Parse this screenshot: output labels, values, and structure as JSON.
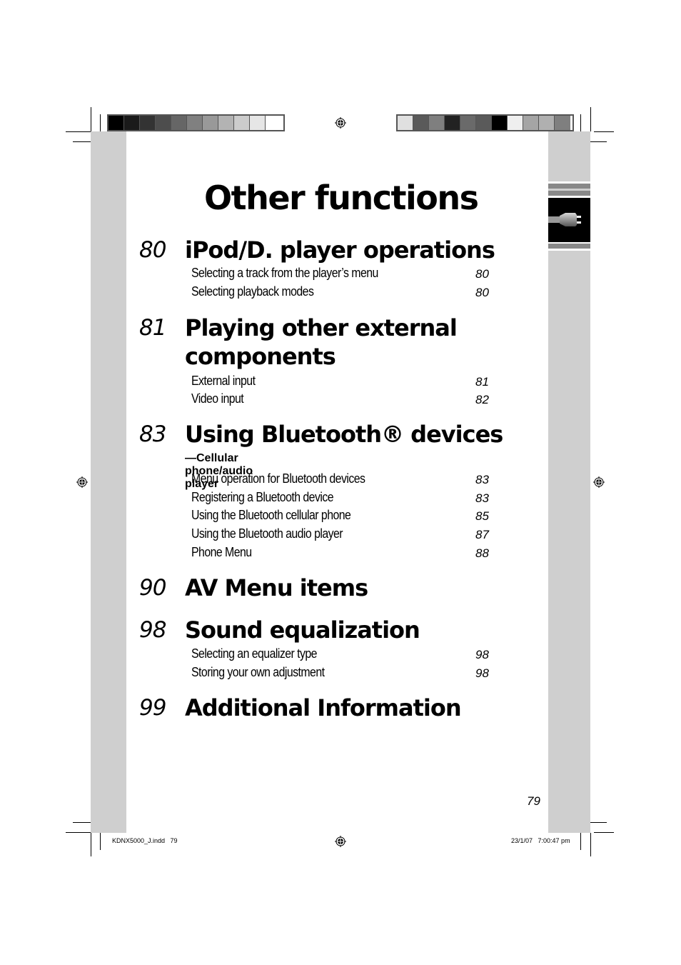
{
  "page": {
    "title": "Other functions",
    "page_number": "79"
  },
  "sections": [
    {
      "page": "80",
      "title": "iPod/D. player operations",
      "items": [
        {
          "label": "Selecting a track from the player’s menu",
          "page": "80"
        },
        {
          "label": "Selecting playback modes",
          "page": "80"
        }
      ]
    },
    {
      "page": "81",
      "title_line1": "Playing other external",
      "title_line2": "components",
      "items": [
        {
          "label": "External input",
          "page": "81"
        },
        {
          "label": "Video input",
          "page": "82"
        }
      ]
    },
    {
      "page": "83",
      "title": "Using Bluetooth® devices",
      "subtitle": "—Cellular phone/audio player",
      "items": [
        {
          "label": "Menu operation for Bluetooth devices",
          "page": "83"
        },
        {
          "label": "Registering a Bluetooth device",
          "page": "83"
        },
        {
          "label": "Using the Bluetooth cellular phone",
          "page": "85"
        },
        {
          "label": "Using the Bluetooth audio player",
          "page": "87"
        },
        {
          "label": "Phone Menu",
          "page": "88"
        }
      ]
    },
    {
      "page": "90",
      "title": "AV Menu items",
      "items": []
    },
    {
      "page": "98",
      "title": "Sound equalization",
      "items": [
        {
          "label": "Selecting an equalizer type",
          "page": "98"
        },
        {
          "label": "Storing your own adjustment",
          "page": "98"
        }
      ]
    },
    {
      "page": "99",
      "title": "Additional Information",
      "items": []
    }
  ],
  "print_slug": {
    "file": "KDNX5000_J.indd   79",
    "timestamp": "23/1/07   7:00:47 pm"
  },
  "tab_icon": "connector-plug-icon",
  "color_bars": {
    "left": [
      "#000000",
      "#1a1a1a",
      "#333333",
      "#4d4d4d",
      "#666666",
      "#808080",
      "#999999",
      "#b3b3b3",
      "#cccccc",
      "#e6e6e6",
      "#ffffff"
    ],
    "right": [
      "#e0e0e0",
      "#5a5a5a",
      "#7f7f7f",
      "#222222",
      "#6a6a6a",
      "#5a5a5a",
      "#000000",
      "#efefef",
      "#a5a5a5",
      "#b0b0b0",
      "#7f7f7f"
    ]
  }
}
